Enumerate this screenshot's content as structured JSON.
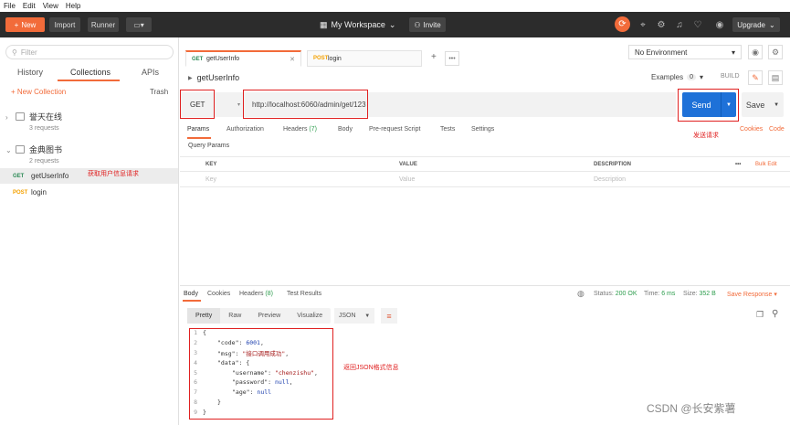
{
  "menubar": [
    "File",
    "Edit",
    "View",
    "Help"
  ],
  "topbar": {
    "new_label": "New",
    "import_label": "Import",
    "runner_label": "Runner",
    "workspace_label": "My Workspace",
    "invite_label": "Invite",
    "upgrade_label": "Upgrade",
    "accent": "#f26b3a"
  },
  "sidebar": {
    "filter_placeholder": "Filter",
    "tabs": [
      "History",
      "Collections",
      "APIs"
    ],
    "active_tab": "Collections",
    "new_collection": "+ New Collection",
    "trash": "Trash",
    "collections": [
      {
        "name": "誉天在线",
        "count": "3 requests"
      },
      {
        "name": "金典图书",
        "count": "2 requests"
      }
    ],
    "requests": [
      {
        "method": "GET",
        "name": "getUserInfo"
      },
      {
        "method": "POST",
        "name": "login"
      }
    ],
    "annotation": "获取用户信息请求"
  },
  "tabs": [
    {
      "method": "GET",
      "name": "getUserInfo",
      "active": true
    },
    {
      "method": "POST",
      "name": "login",
      "active": false
    }
  ],
  "environment": "No Environment",
  "request": {
    "title": "getUserInfo",
    "examples_label": "Examples",
    "examples_count": "0",
    "build_label": "BUILD",
    "method": "GET",
    "url": "http://localhost:6060/admin/get/123",
    "send_label": "Send",
    "save_label": "Save",
    "send_annotation": "发送请求"
  },
  "param_tabs": {
    "items": [
      "Params",
      "Authorization",
      "Headers",
      "Body",
      "Pre-request Script",
      "Tests",
      "Settings"
    ],
    "headers_count": "(7)",
    "cookies": "Cookies",
    "code": "Code",
    "query_params": "Query Params"
  },
  "params_table": {
    "headers": [
      "KEY",
      "VALUE",
      "DESCRIPTION"
    ],
    "more": "•••",
    "bulk_edit": "Bulk Edit",
    "placeholders": [
      "Key",
      "Value",
      "Description"
    ]
  },
  "response": {
    "tabs": [
      "Body",
      "Cookies",
      "Headers",
      "Test Results"
    ],
    "headers_count": "(8)",
    "status_label": "Status:",
    "status_value": "200 OK",
    "time_label": "Time:",
    "time_value": "6 ms",
    "size_label": "Size:",
    "size_value": "352 B",
    "save_response": "Save Response",
    "view_modes": [
      "Pretty",
      "Raw",
      "Preview",
      "Visualize"
    ],
    "format": "JSON",
    "json_annotation": "返回JSON格式信息",
    "code_lines": [
      {
        "n": "1",
        "indent": 0,
        "parts": [
          {
            "t": "{",
            "c": "k"
          }
        ]
      },
      {
        "n": "2",
        "indent": 1,
        "parts": [
          {
            "t": "\"code\": ",
            "c": "k"
          },
          {
            "t": "6001",
            "c": "n"
          },
          {
            "t": ",",
            "c": "k"
          }
        ]
      },
      {
        "n": "3",
        "indent": 1,
        "parts": [
          {
            "t": "\"msg\": ",
            "c": "k"
          },
          {
            "t": "\"接口调用成功\"",
            "c": "s"
          },
          {
            "t": ",",
            "c": "k"
          }
        ]
      },
      {
        "n": "4",
        "indent": 1,
        "parts": [
          {
            "t": "\"data\": {",
            "c": "k"
          }
        ]
      },
      {
        "n": "5",
        "indent": 2,
        "parts": [
          {
            "t": "\"username\": ",
            "c": "k"
          },
          {
            "t": "\"chenzishu\"",
            "c": "s"
          },
          {
            "t": ",",
            "c": "k"
          }
        ]
      },
      {
        "n": "6",
        "indent": 2,
        "parts": [
          {
            "t": "\"password\": ",
            "c": "k"
          },
          {
            "t": "null",
            "c": "n"
          },
          {
            "t": ",",
            "c": "k"
          }
        ]
      },
      {
        "n": "7",
        "indent": 2,
        "parts": [
          {
            "t": "\"age\": ",
            "c": "k"
          },
          {
            "t": "null",
            "c": "n"
          }
        ]
      },
      {
        "n": "8",
        "indent": 1,
        "parts": [
          {
            "t": "}",
            "c": "k"
          }
        ]
      },
      {
        "n": "9",
        "indent": 0,
        "parts": [
          {
            "t": "}",
            "c": "k"
          }
        ]
      }
    ]
  },
  "watermark": "CSDN @长安紫薯"
}
